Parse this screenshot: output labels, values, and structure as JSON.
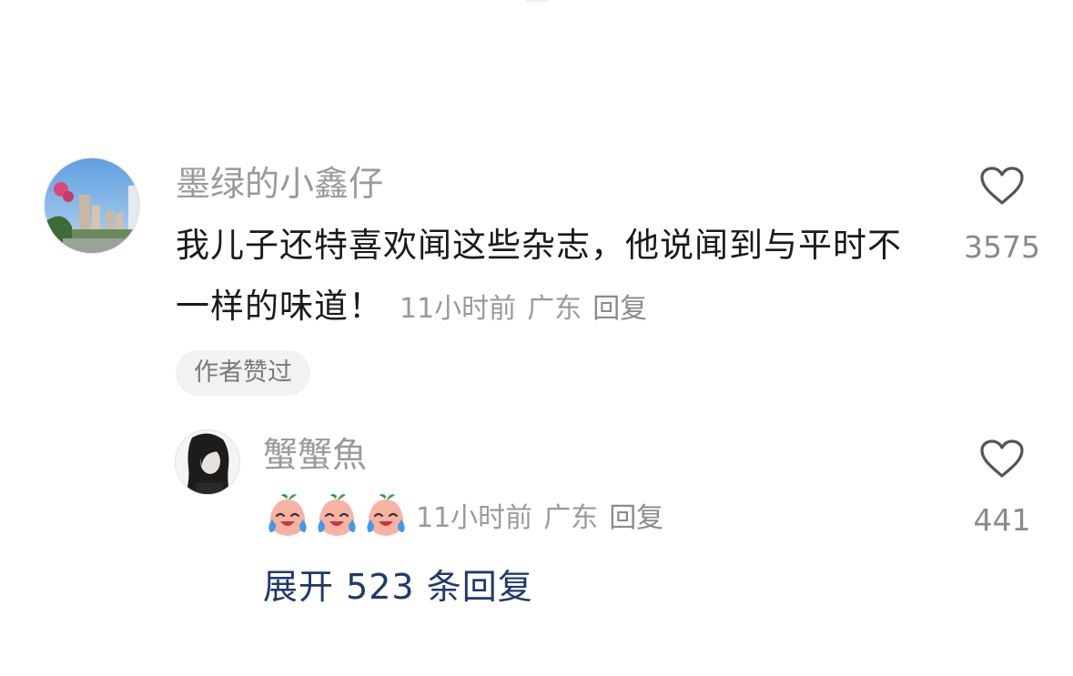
{
  "comment": {
    "username": "墨绿的小鑫仔",
    "text": "我儿子还特喜欢闻这些杂志，他说闻到与平时不一样的味道！",
    "time": "11小时前",
    "location": "广东",
    "reply_label": "回复",
    "like_count": "3575",
    "author_badge": "作者赞过"
  },
  "reply": {
    "username": "蟹蟹魚",
    "emojis": [
      "crying-laughing-peach-emoji",
      "crying-laughing-peach-emoji",
      "crying-laughing-peach-emoji"
    ],
    "time": "11小时前",
    "location": "广东",
    "reply_label": "回复",
    "like_count": "441"
  },
  "expand_replies_label": "展开 523 条回复",
  "icons": {
    "like": "heart-outline-icon"
  },
  "colors": {
    "username": "#9a9a9a",
    "text": "#1a1a1a",
    "meta": "#9a9a9a",
    "expand_link": "#1e3a6b",
    "badge_bg": "#f2f2f2"
  }
}
